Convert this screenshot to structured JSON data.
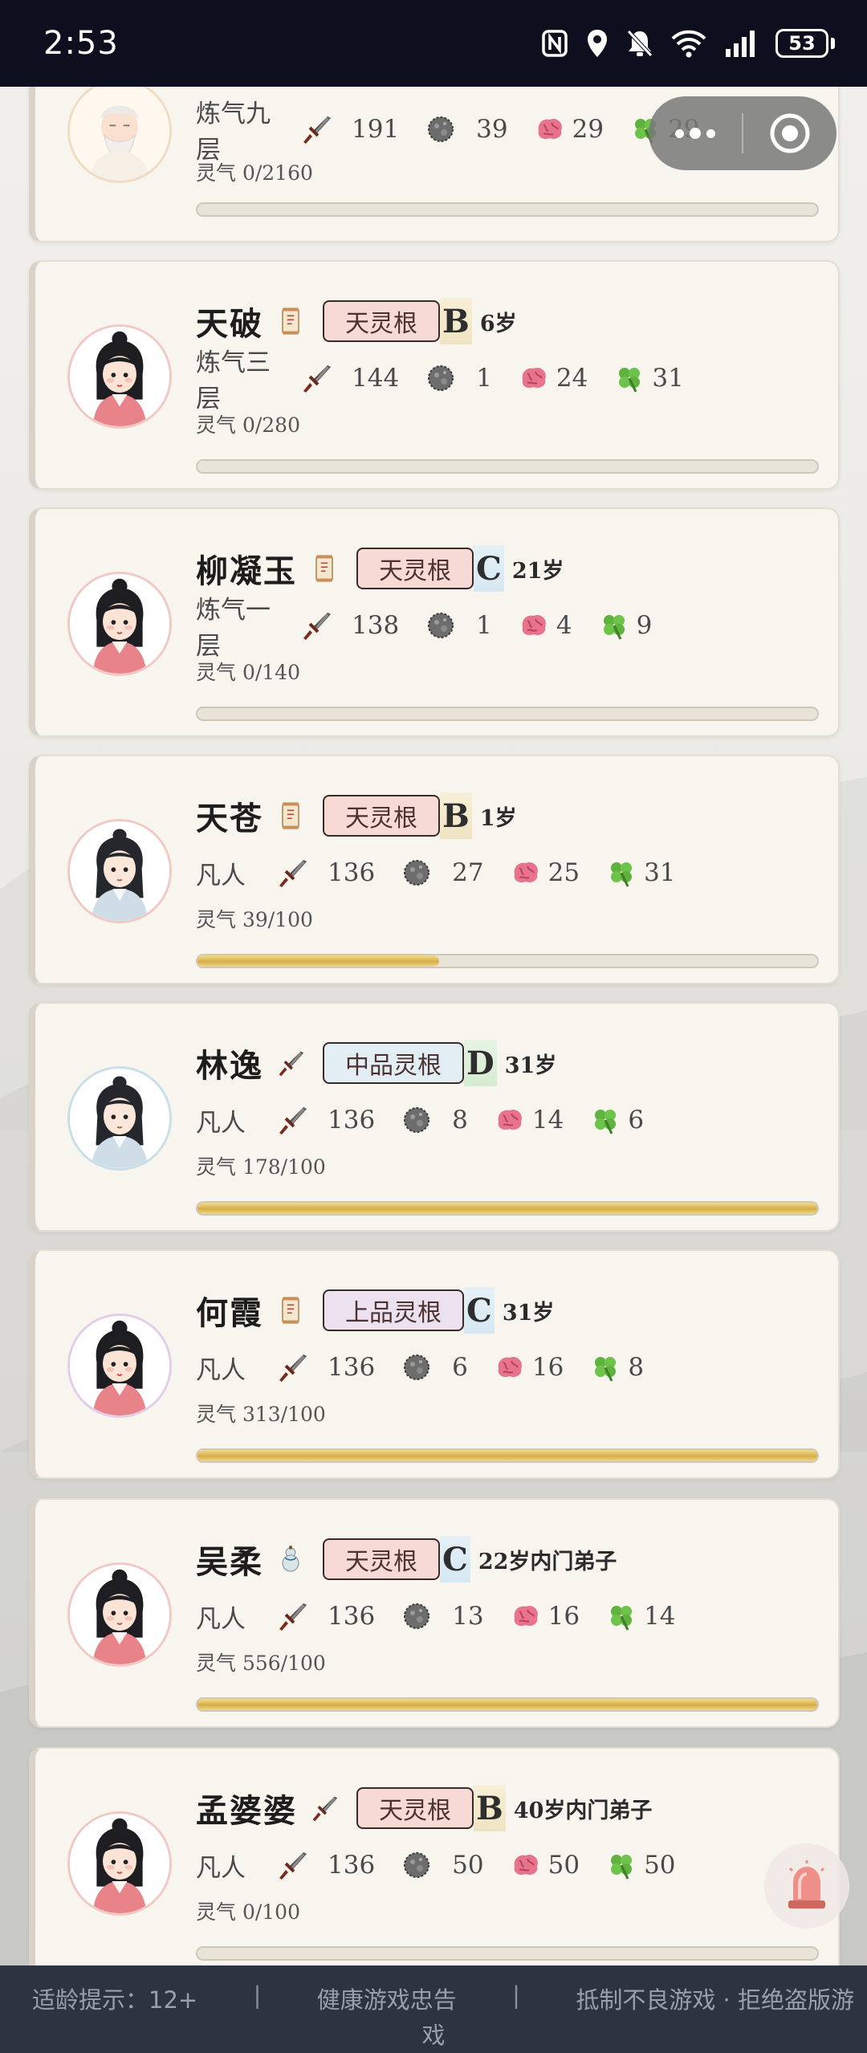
{
  "status_bar": {
    "time": "2:53",
    "battery": "53"
  },
  "capsule": {
    "more_icon": "more-dots-icon",
    "close_icon": "target-circle-icon"
  },
  "icons": {
    "attack": "sword-icon",
    "defense": "stone-icon",
    "intellect": "brain-icon",
    "luck": "clover-icon"
  },
  "disciples": [
    {
      "name": "",
      "realm": "炼气九层",
      "attack": "191",
      "defense": "39",
      "intellect": "29",
      "luck": "29",
      "qi": "灵气 0/2160",
      "progress": 0,
      "avatar": "old-master"
    },
    {
      "name": "天破",
      "tag": "scroll-icon",
      "root": "天灵根",
      "grade": "B",
      "age": "6岁",
      "realm": "炼气三层",
      "attack": "144",
      "defense": "1",
      "intellect": "24",
      "luck": "31",
      "qi": "灵气 0/280",
      "progress": 0,
      "avatar": "cyan-girl"
    },
    {
      "name": "柳凝玉",
      "tag": "scroll-icon",
      "root": "天灵根",
      "grade": "C",
      "age": "21岁",
      "realm": "炼气一层",
      "attack": "138",
      "defense": "1",
      "intellect": "4",
      "luck": "9",
      "qi": "灵气 0/140",
      "progress": 0,
      "avatar": "red-girl"
    },
    {
      "name": "天苍",
      "tag": "scroll-icon",
      "root": "天灵根",
      "grade": "B",
      "age": "1岁",
      "realm": "凡人",
      "attack": "136",
      "defense": "27",
      "intellect": "25",
      "luck": "31",
      "qi": "灵气 39/100",
      "progress": 0.39,
      "avatar": "grey-boy"
    },
    {
      "name": "林逸",
      "tag": "sword-icon",
      "root": "中品灵根",
      "grade": "D",
      "age": "31岁",
      "realm": "凡人",
      "attack": "136",
      "defense": "8",
      "intellect": "14",
      "luck": "6",
      "qi": "灵气 178/100",
      "progress": 1,
      "avatar": "blue-boy"
    },
    {
      "name": "何霞",
      "tag": "scroll-icon",
      "root": "上品灵根",
      "grade": "C",
      "age": "31岁",
      "realm": "凡人",
      "attack": "136",
      "defense": "6",
      "intellect": "16",
      "luck": "8",
      "qi": "灵气 313/100",
      "progress": 1,
      "avatar": "purple-girl"
    },
    {
      "name": "吴柔",
      "tag": "gourd-icon",
      "root": "天灵根",
      "grade": "C",
      "age": "22岁内门弟子",
      "realm": "凡人",
      "attack": "136",
      "defense": "13",
      "intellect": "16",
      "luck": "14",
      "qi": "灵气 556/100",
      "progress": 1,
      "avatar": "red-girl"
    },
    {
      "name": "孟婆婆",
      "tag": "sword-icon",
      "root": "天灵根",
      "grade": "B",
      "age": "40岁内门弟子",
      "realm": "凡人",
      "attack": "136",
      "defense": "50",
      "intellect": "50",
      "luck": "50",
      "qi": "灵气 0/100",
      "progress": 0,
      "avatar": "red-girl"
    }
  ],
  "alarm": {
    "icon": "alarm-siren-icon"
  },
  "footer": {
    "age_hint": "适龄提示：12+",
    "sep1": "|",
    "health": "健康游戏忠告",
    "sep2": "|",
    "anti_line1": "抵制不良游戏 · 拒绝盗版游",
    "anti_line2": "戏"
  }
}
